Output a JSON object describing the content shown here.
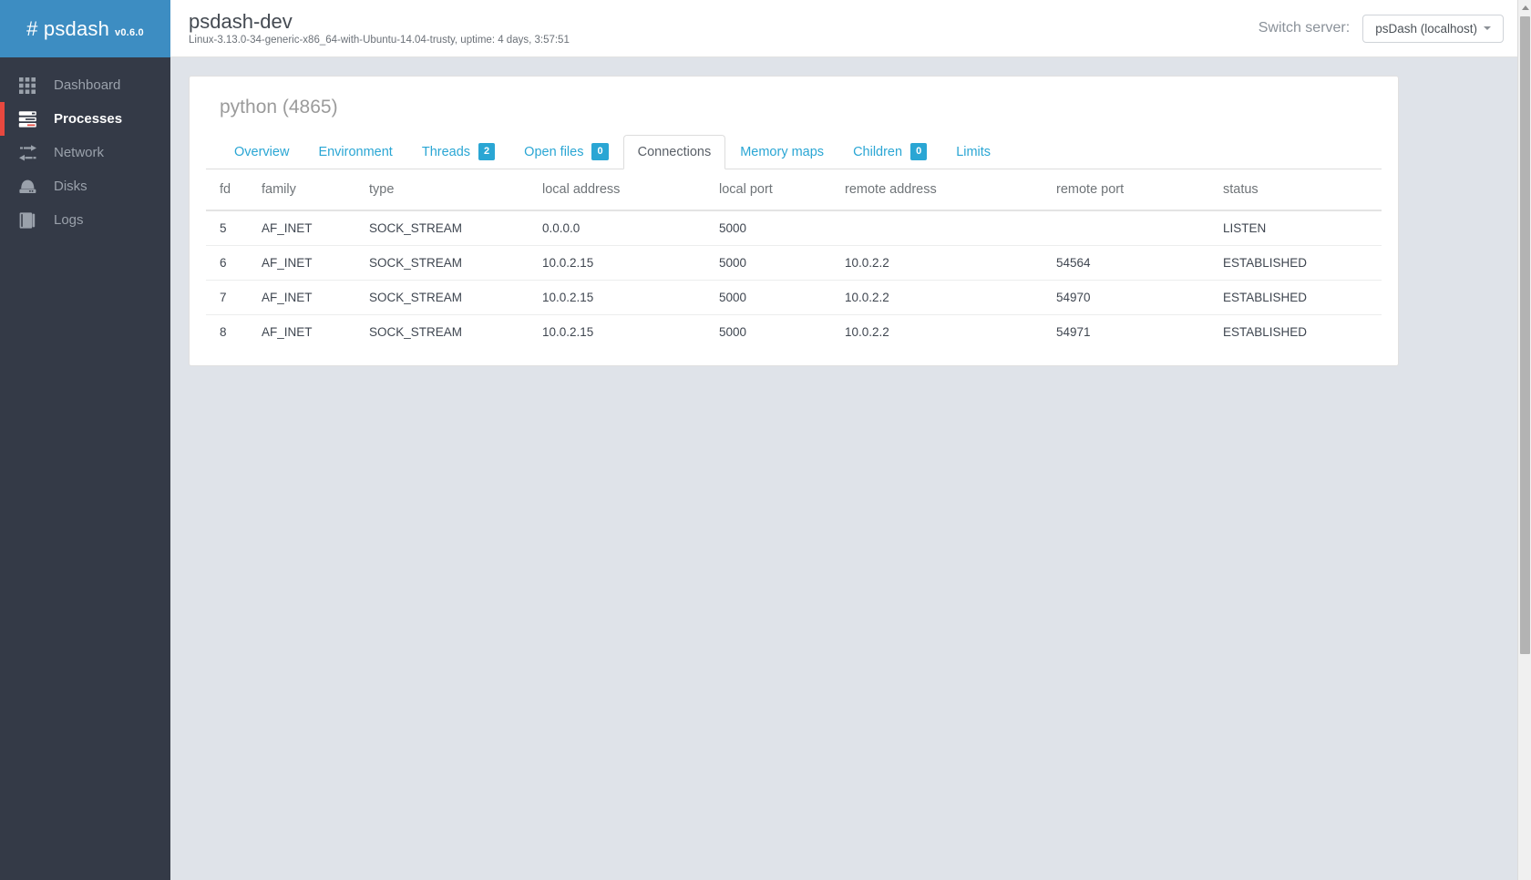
{
  "brand": {
    "name": "# psdash",
    "version": "v0.6.0"
  },
  "sidebar": {
    "items": [
      {
        "label": "Dashboard",
        "icon": "grid-icon",
        "active": false
      },
      {
        "label": "Processes",
        "icon": "server-icon",
        "active": true
      },
      {
        "label": "Network",
        "icon": "network-icon",
        "active": false
      },
      {
        "label": "Disks",
        "icon": "disk-icon",
        "active": false
      },
      {
        "label": "Logs",
        "icon": "book-icon",
        "active": false
      }
    ]
  },
  "topbar": {
    "title": "psdash-dev",
    "subtitle": "Linux-3.13.0-34-generic-x86_64-with-Ubuntu-14.04-trusty, uptime: 4 days, 3:57:51",
    "switch_server_label": "Switch server:",
    "server_selected": "psDash (localhost)",
    "server_options": [
      "psDash (localhost)"
    ]
  },
  "panel": {
    "process_title": "python (4865)",
    "tabs": [
      {
        "label": "Overview",
        "badge": null,
        "active": false
      },
      {
        "label": "Environment",
        "badge": null,
        "active": false
      },
      {
        "label": "Threads",
        "badge": "2",
        "active": false
      },
      {
        "label": "Open files",
        "badge": "0",
        "active": false
      },
      {
        "label": "Connections",
        "badge": null,
        "active": true
      },
      {
        "label": "Memory maps",
        "badge": null,
        "active": false
      },
      {
        "label": "Children",
        "badge": "0",
        "active": false
      },
      {
        "label": "Limits",
        "badge": null,
        "active": false
      }
    ],
    "table": {
      "columns": [
        "fd",
        "family",
        "type",
        "local address",
        "local port",
        "remote address",
        "remote port",
        "status"
      ],
      "rows": [
        [
          "5",
          "AF_INET",
          "SOCK_STREAM",
          "0.0.0.0",
          "5000",
          "",
          "",
          "LISTEN"
        ],
        [
          "6",
          "AF_INET",
          "SOCK_STREAM",
          "10.0.2.15",
          "5000",
          "10.0.2.2",
          "54564",
          "ESTABLISHED"
        ],
        [
          "7",
          "AF_INET",
          "SOCK_STREAM",
          "10.0.2.15",
          "5000",
          "10.0.2.2",
          "54970",
          "ESTABLISHED"
        ],
        [
          "8",
          "AF_INET",
          "SOCK_STREAM",
          "10.0.2.15",
          "5000",
          "10.0.2.2",
          "54971",
          "ESTABLISHED"
        ]
      ]
    }
  },
  "colors": {
    "brand_blue": "#3d8dc2",
    "sidebar_dark": "#343a47",
    "active_marker_red": "#e8483f",
    "link_blue": "#2aa6d4",
    "badge_blue": "#2aa6d4",
    "page_background": "#dfe3e9"
  }
}
